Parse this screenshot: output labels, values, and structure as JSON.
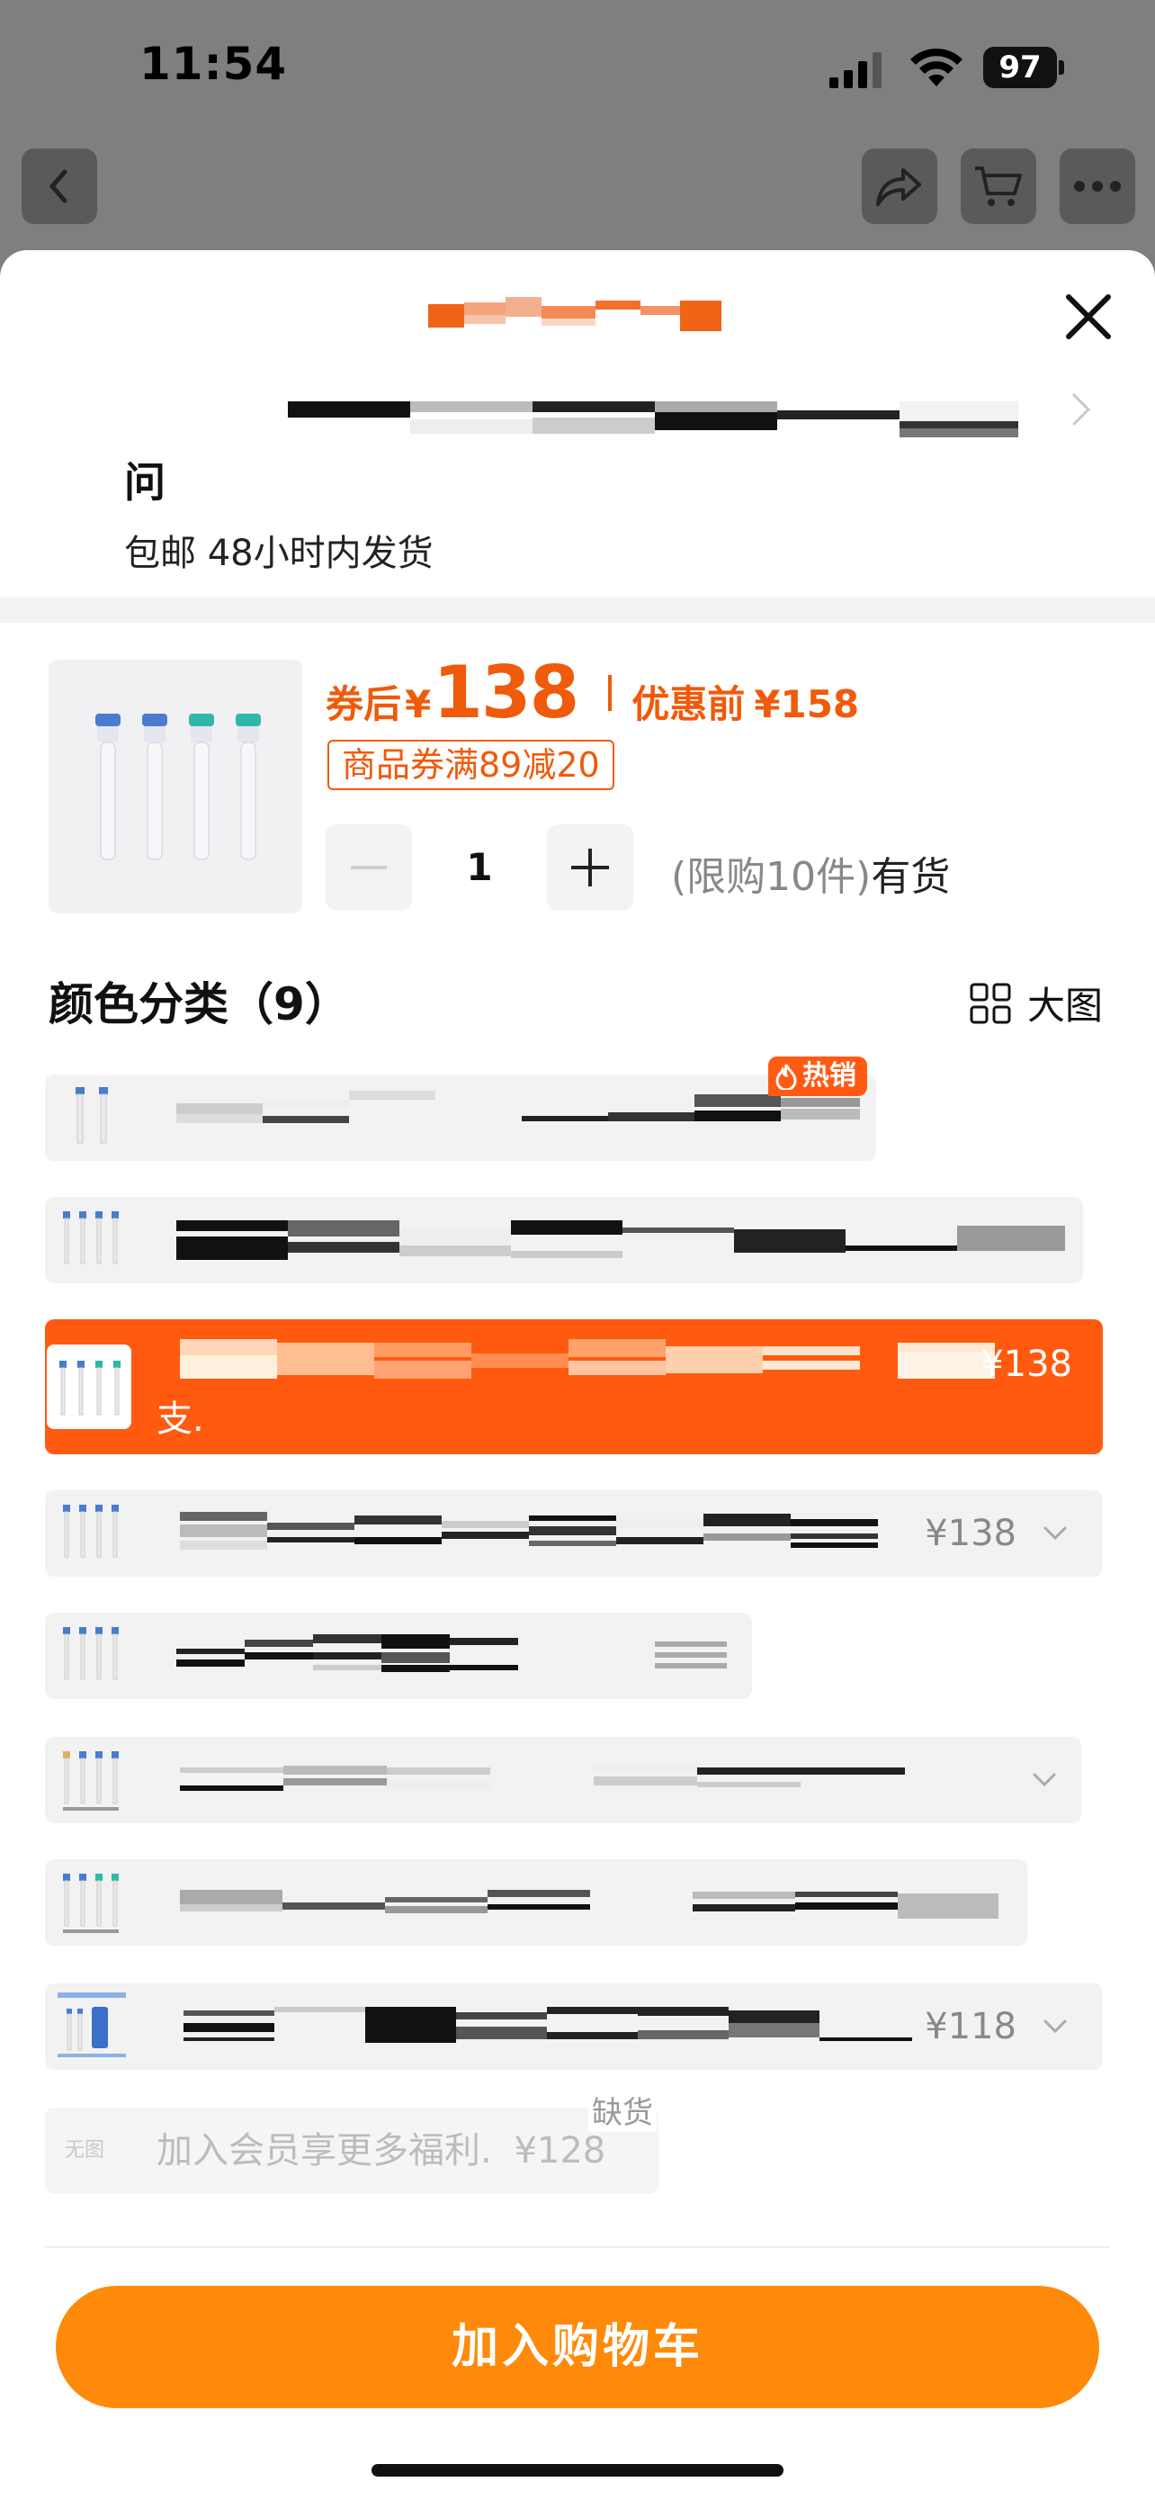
{
  "status_bar": {
    "time": "11:54",
    "battery": "97"
  },
  "nav": {
    "back_icon": "chevron-left-icon",
    "share_icon": "share-icon",
    "cart_icon": "cart-icon",
    "more_icon": "more-icon"
  },
  "sheet": {
    "title": "问",
    "shipping": "包邮 48小时内发货"
  },
  "product": {
    "price_label": "券后",
    "currency": "¥",
    "price": "138",
    "price_before_label": "优惠前",
    "price_before": "¥158",
    "coupon": "商品券满89减20",
    "quantity": "1",
    "limit": "(限购10件)",
    "availability": "有货"
  },
  "variants_section": {
    "title": "颜色分类（9）",
    "big_view_label": "大图",
    "hot_badge": "热销",
    "selected_price": "¥138",
    "selected_text": "支.",
    "variant4_price": "¥138",
    "variant8_price": "¥118",
    "disabled_text": "加入会员享更多福利.",
    "disabled_price": "¥128",
    "no_image": "无图",
    "out_of_stock": "缺货"
  },
  "actions": {
    "add_to_cart": "加入购物车"
  },
  "colors": {
    "accent": "#ff5a0f",
    "price": "#f05a0b",
    "button": "#ff8a0a"
  }
}
